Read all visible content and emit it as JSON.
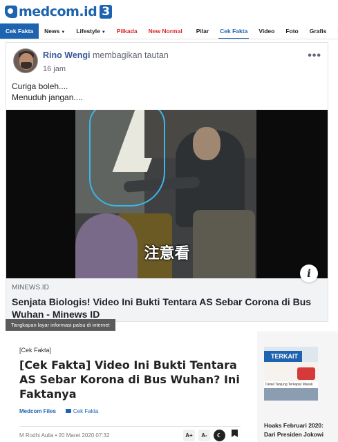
{
  "header": {
    "logo_text": "medcom.id",
    "logo_badge": "3"
  },
  "nav": {
    "items": [
      {
        "label": "Cek Fakta",
        "style": "active-first"
      },
      {
        "label": "News",
        "dropdown": true
      },
      {
        "label": "Lifestyle",
        "dropdown": true
      },
      {
        "label": "Pilkada",
        "style": "red"
      },
      {
        "label": "New Normal",
        "style": "red"
      },
      {
        "label": "Pilar"
      },
      {
        "label": "Cek Fakta",
        "style": "current"
      },
      {
        "label": "Video"
      },
      {
        "label": "Foto"
      },
      {
        "label": "Grafis"
      },
      {
        "label": "Live T"
      }
    ]
  },
  "fb_post": {
    "author": "Rino Wengi",
    "action": "membagikan tautan",
    "time": "16 jam",
    "text_line1": "Curiga boleh....",
    "text_line2": "Menuduh jangan....",
    "video_overlay_text": "注意看",
    "link_domain": "MINEWS.ID",
    "link_title": "Senjata Biologis! Video Ini Bukti Tentara AS Sebar Corona di Bus Wuhan - Minews ID",
    "more_icon": "ellipsis-icon",
    "info_icon": "info-icon"
  },
  "image_caption": "Tangkapan layar informasi palsu di internet",
  "article": {
    "kicker": "[Cek Fakta]",
    "title": "[Cek Fakta] Video Ini Bukti Tentara AS Sebar Korona di Bus Wuhan? Ini Faktanya",
    "source": "Medcom Files",
    "category": "Cek Fakta",
    "byline": "M Rodhi Aulia • 20 Maret 2020 07:32",
    "tools": {
      "font_up": "A+",
      "font_down": "A-"
    }
  },
  "sidebar": {
    "label": "TERKAIT",
    "thumb_caption": "Detail Tanjung Terkapar Masuk Rumah",
    "title": "Hoaks Februari 2020: Dari Presiden Jokowi"
  },
  "colors": {
    "brand_blue": "#1d63b0",
    "nav_red": "#d9262a",
    "fb_link_blue": "#385898"
  }
}
